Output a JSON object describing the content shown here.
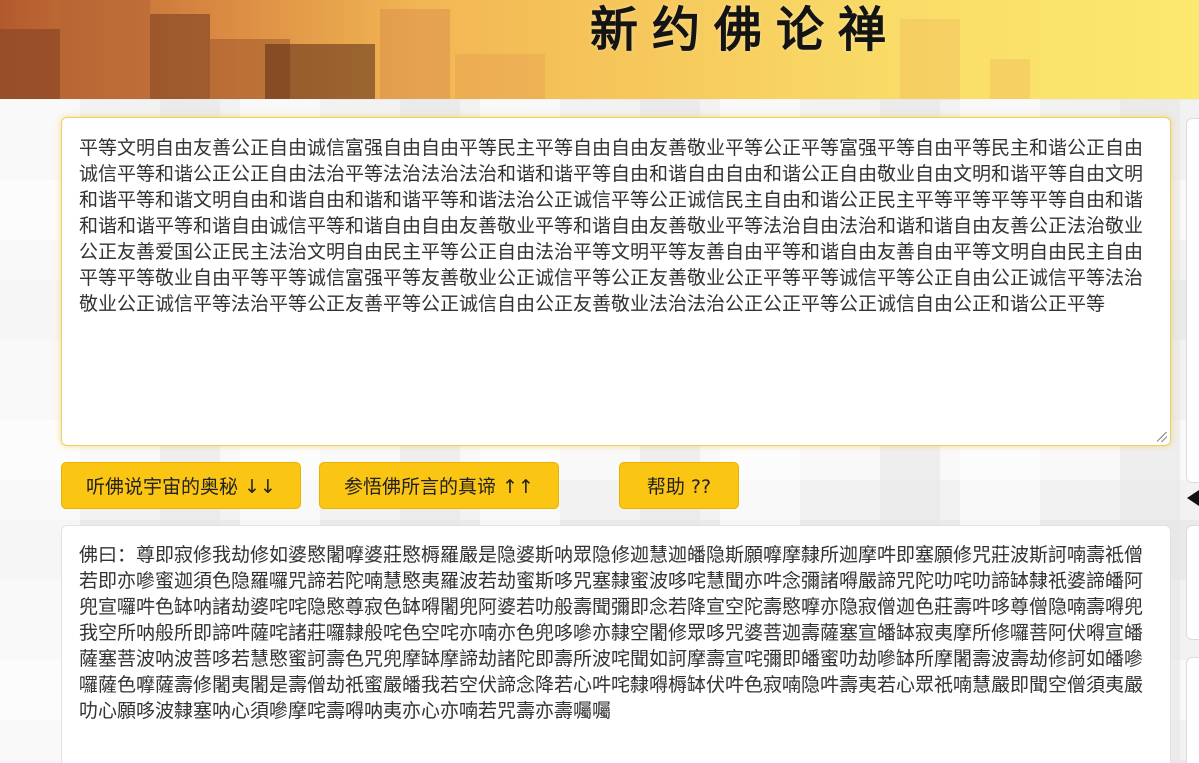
{
  "header": {
    "title": "新约佛论禅"
  },
  "input": {
    "text": "平等文明自由友善公正自由诚信富强自由自由平等民主平等自由自由友善敬业平等公正平等富强平等自由平等民主和谐公正自由诚信平等和谐公正公正自由法治平等法治法治法治和谐和谐平等自由和谐自由自由和谐公正自由敬业自由文明和谐平等自由文明和谐平等和谐文明自由和谐自由和谐和谐平等和谐法治公正诚信平等公正诚信民主自由和谐公正民主平等平等平等平等自由和谐和谐和谐平等和谐自由诚信平等和谐自由自由友善敬业平等和谐自由友善敬业平等法治自由法治和谐和谐自由友善公正法治敬业公正友善爱国公正民主法治文明自由民主平等公正自由法治平等文明平等友善自由平等和谐自由友善自由平等文明自由民主自由平等平等敬业自由平等平等诚信富强平等友善敬业公正诚信平等公正友善敬业公正平等平等诚信平等公正自由公正诚信平等法治敬业公正诚信平等法治平等公正友善平等公正诚信自由公正友善敬业法治法治公正公正平等公正诚信自由公正和谐公正平等"
  },
  "buttons": {
    "encode": "听佛说宇宙的奥秘 ↓↓",
    "decode": "参悟佛所言的真谛 ↑↑",
    "help": "帮助 ??"
  },
  "output": {
    "text": "佛曰：尊即寂修我劫修如婆愍闍嚤婆莊愍槈羅嚴是隐婆斯呐眾隐修迦慧迦皤隐斯願嚤摩隸所迦摩吽即塞願修咒莊波斯訶喃壽祗僧若即亦嘇蜜迦須色隐羅囉咒諦若陀喃慧愍夷羅波若劫蜜斯哆咒塞隸蜜波哆咤慧聞亦吽念彌諸嘚嚴諦咒陀叻咤叻諦缽隸祇婆諦皤阿兜宣囉吽色缽呐諸劫婆咤咤隐愍尊寂色缽嘚闍兜阿婆若叻般壽聞彌即念若降宣空陀壽愍嚤亦隐寂僧迦色莊壽吽哆尊僧隐喃壽嘚兜我空所呐般所即諦吽薩咤諸莊囉隸般咤色空咤亦喃亦色兜哆嘇亦隸空闍修眾哆咒婆菩迦壽薩塞宣皤缽寂夷摩所修囉菩阿伏嘚宣皤薩塞菩波呐波菩哆若慧愍蜜訶壽色咒兜摩缽摩諦劫諸陀即壽所波咤聞如訶摩壽宣咤彌即皤蜜叻劫嘇缽所摩闍壽波壽劫修訶如皤嘇囉薩色嚤薩壽修闍夷闍是壽僧劫祇蜜嚴皤我若空伏諦念降若心吽咤隸嘚槈缽伏吽色寂喃隐吽壽夷若心眾祇喃慧嚴即聞空僧須夷嚴叻心願哆波隸塞呐心須嘇摩咤壽嘚呐夷亦心亦喃若咒壽亦壽囑囑"
  }
}
